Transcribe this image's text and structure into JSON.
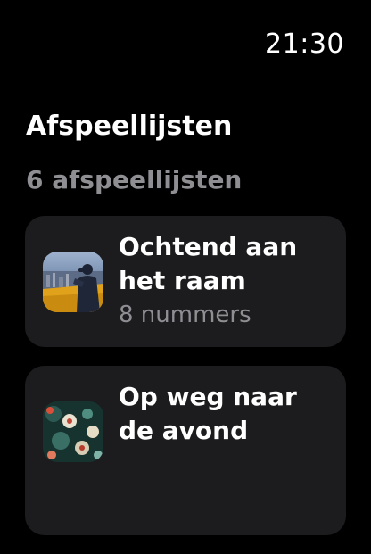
{
  "status": {
    "time": "21:30"
  },
  "header": {
    "title": "Afspeellijsten",
    "subtitle": "6 afspeellijsten"
  },
  "playlists": [
    {
      "title": "Ochtend aan het raam",
      "count": "8 nummers",
      "artwork_icon": "person-at-window-artwork"
    },
    {
      "title": "Op weg naar de avond",
      "count": "",
      "artwork_icon": "abstract-floral-artwork"
    }
  ],
  "colors": {
    "background": "#000000",
    "card": "#1c1c1e",
    "secondary_text": "#8e8e93",
    "primary_text": "#ffffff"
  }
}
